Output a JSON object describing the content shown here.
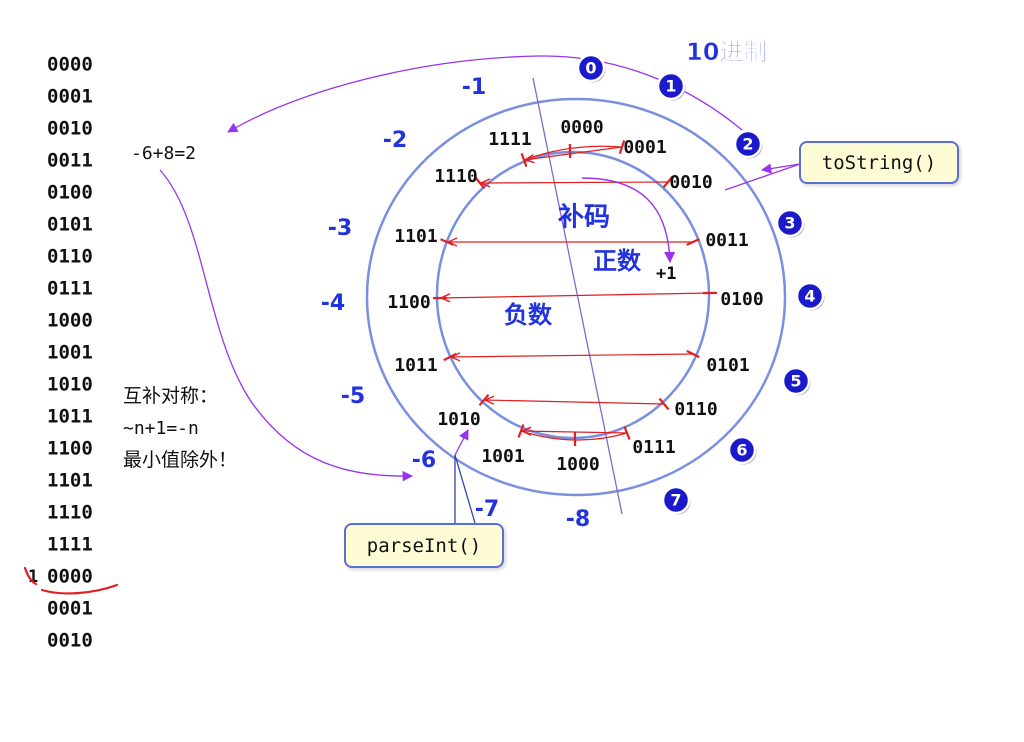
{
  "binary_list": [
    "0000",
    "0001",
    "0010",
    "0011",
    "0100",
    "0101",
    "0110",
    "0111",
    "1000",
    "1001",
    "1010",
    "1011",
    "1100",
    "1101",
    "1110",
    "1111",
    "0000",
    "0001",
    "0010"
  ],
  "carry_digit": "1",
  "equation": "-6+8=2",
  "symmetry_note": {
    "title": "互补对称：",
    "formula": "~n+1=-n",
    "exception": "最小值除外！"
  },
  "header_label": "10进制",
  "ring_codes": [
    "0000",
    "0001",
    "0010",
    "0011",
    "0100",
    "0101",
    "0110",
    "0111",
    "1000",
    "1001",
    "1010",
    "1011",
    "1100",
    "1101",
    "1110",
    "1111"
  ],
  "positive_decimals": [
    "0",
    "1",
    "2",
    "3",
    "4",
    "5",
    "6",
    "7"
  ],
  "negative_decimals": [
    "-1",
    "-2",
    "-3",
    "-4",
    "-5",
    "-6",
    "-7",
    "-8"
  ],
  "inner_labels": {
    "complement": "补码",
    "positive": "正数",
    "negative": "负数",
    "plus_one": "+1"
  },
  "callouts": {
    "to_string": "toString()",
    "parse_int": "parseInt()"
  },
  "colors": {
    "circle": "#7b8fe0",
    "arrow": "#9933ee",
    "chord": "#e02020",
    "badge": "#1a1acc",
    "label_blue": "#2233dd",
    "callout_bg": "#fdfcd4",
    "callout_border": "#5a6fd6"
  }
}
